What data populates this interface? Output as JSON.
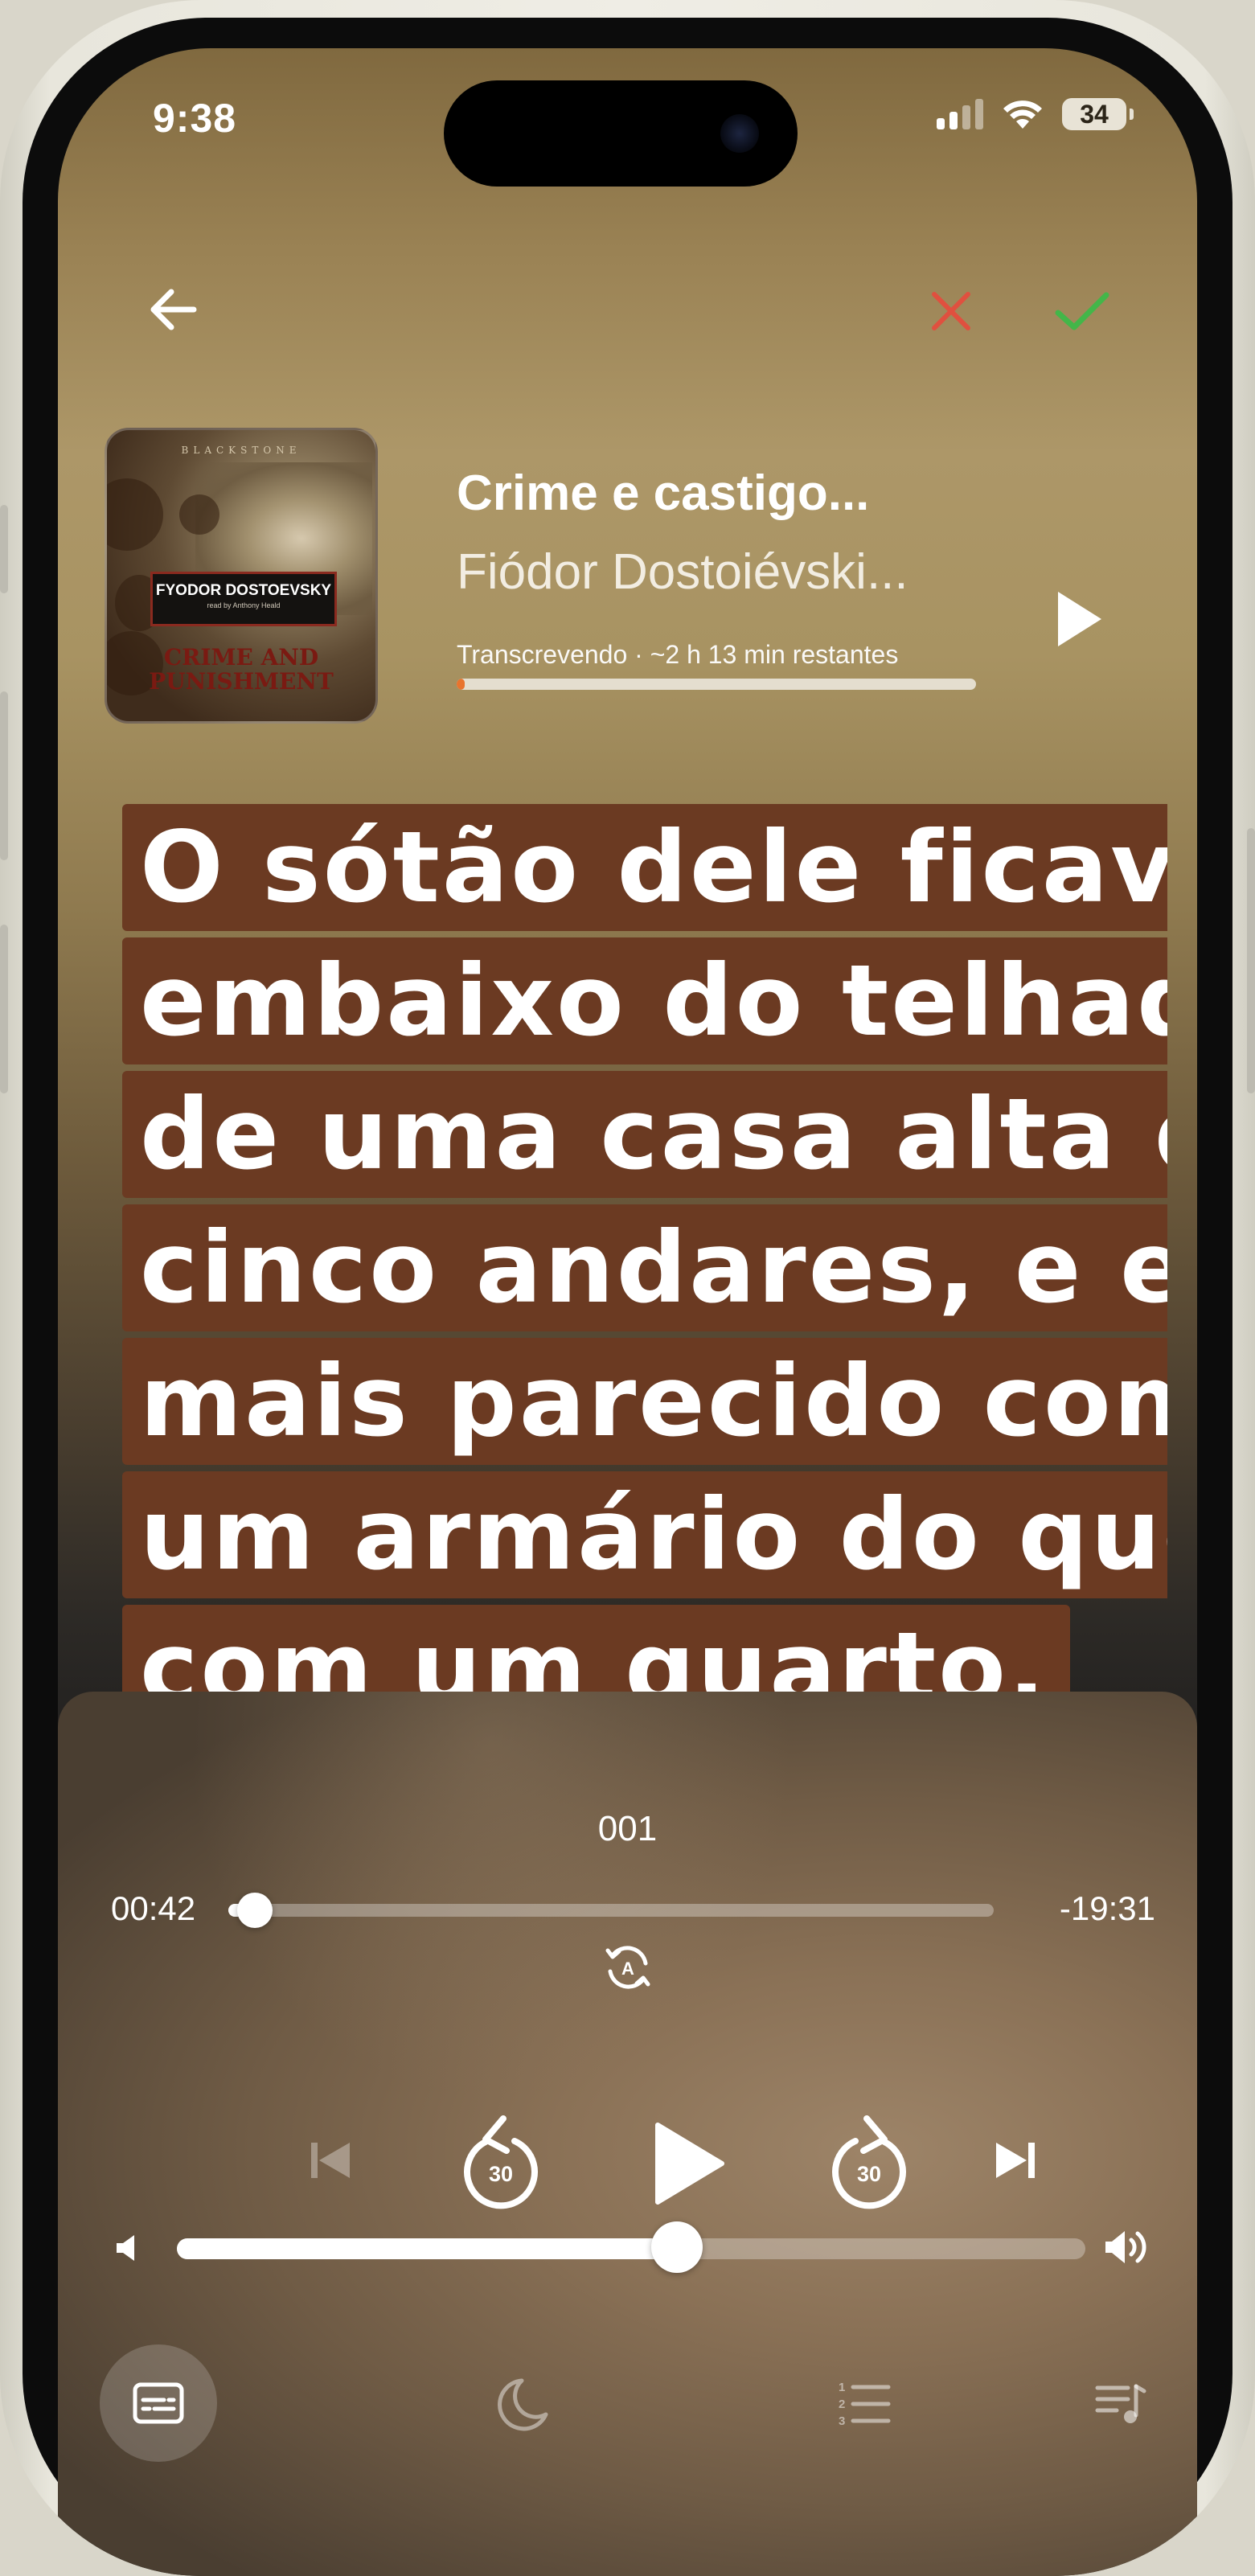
{
  "status_bar": {
    "time": "9:38",
    "battery": "34"
  },
  "header": {
    "back_icon": "arrow-left-icon",
    "reject_icon": "x-icon",
    "reject_color": "#e0503f",
    "accept_icon": "check-icon",
    "accept_color": "#43b649"
  },
  "book": {
    "title": "Crime e castigo...",
    "author": "Fiódor Dostoiévski...",
    "status": "Transcrevendo · ~2 h 13 min restantes",
    "transcription_progress": 0.015,
    "play_icon": "play-icon",
    "cover": {
      "publisher_line": "BLACKSTONE",
      "author": "FYODOR DOSTOEVSKY",
      "reader": "read by Anthony Heald",
      "title_line1": "CRIME AND",
      "title_line2": "PUNISHMENT"
    }
  },
  "transcript": {
    "lines": [
      "O sótão dele ficava",
      "embaixo do telhado",
      "de uma casa alta de",
      "cinco andares, e era",
      "mais parecido com",
      "um armário do que",
      "com um quarto."
    ],
    "highlight_color": "#6b3a22"
  },
  "player": {
    "track": "001",
    "elapsed": "00:42",
    "remaining": "-19:31",
    "seek_position": 0.035,
    "volume": 0.55,
    "skip_back_seconds": "30",
    "skip_forward_seconds": "30",
    "icons": {
      "auto": "auto-rotate-icon",
      "prev": "previous-track-icon",
      "rewind": "rewind-30-icon",
      "play": "play-icon",
      "forward": "forward-30-icon",
      "next": "next-track-icon",
      "volume_low": "speaker-low-icon",
      "volume_high": "speaker-high-icon",
      "subtitles": "subtitles-icon",
      "sleep": "moon-icon",
      "chapters": "numbered-list-icon",
      "queue": "playlist-icon"
    }
  }
}
